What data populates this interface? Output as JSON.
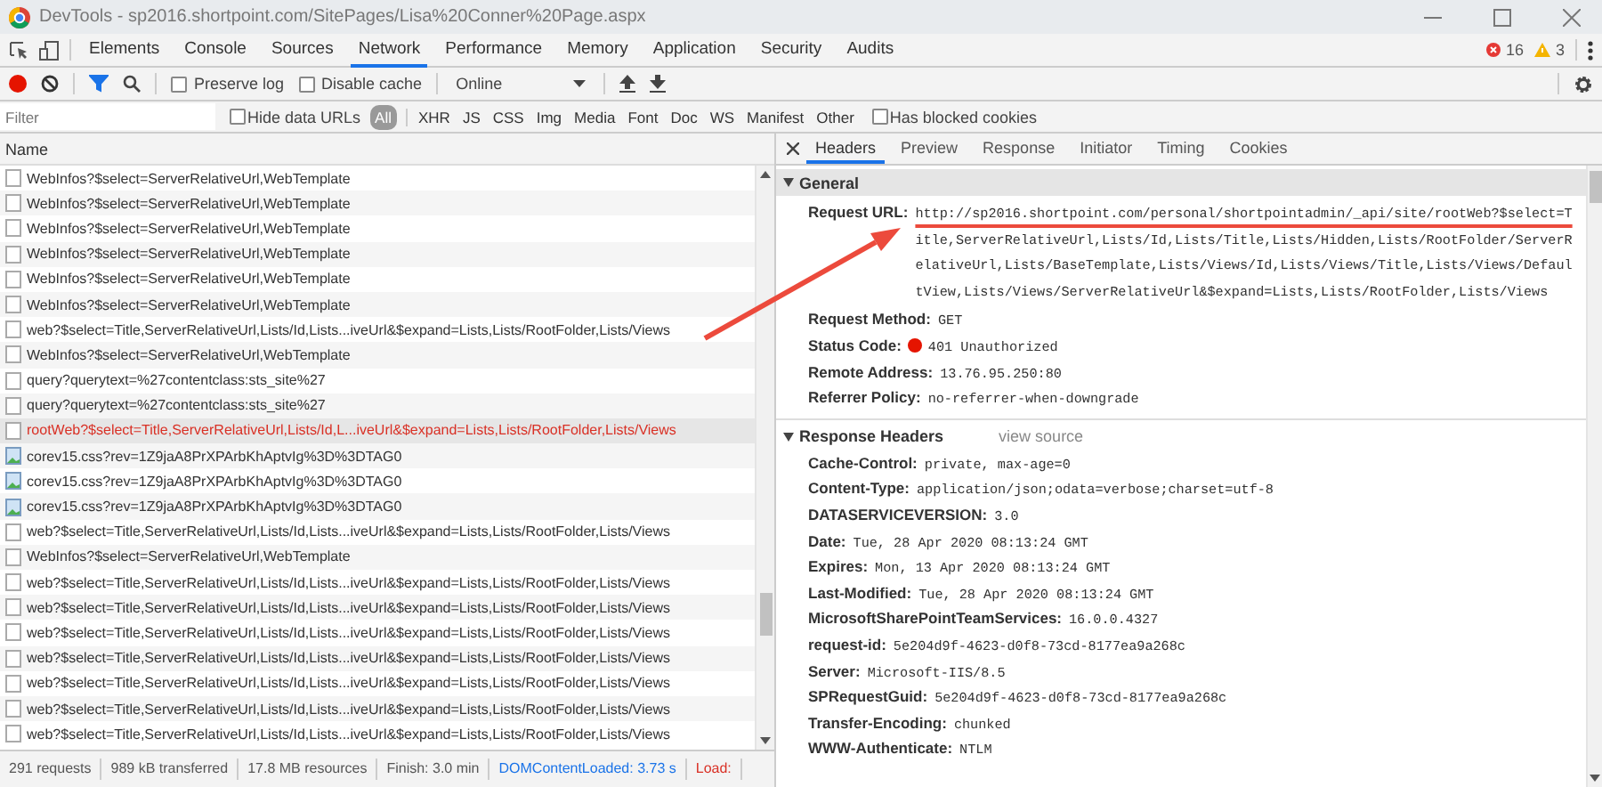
{
  "window": {
    "title": "DevTools - sp2016.shortpoint.com/SitePages/Lisa%20Conner%20Page.aspx"
  },
  "tabs": [
    {
      "label": "Elements",
      "selected": false
    },
    {
      "label": "Console",
      "selected": false
    },
    {
      "label": "Sources",
      "selected": false
    },
    {
      "label": "Network",
      "selected": true
    },
    {
      "label": "Performance",
      "selected": false
    },
    {
      "label": "Memory",
      "selected": false
    },
    {
      "label": "Application",
      "selected": false
    },
    {
      "label": "Security",
      "selected": false
    },
    {
      "label": "Audits",
      "selected": false
    }
  ],
  "counts": {
    "errors": "16",
    "warnings": "3"
  },
  "toolbar": {
    "recording": true,
    "filter_active": true,
    "preserve_log": {
      "label": "Preserve log",
      "checked": false
    },
    "disable_cache": {
      "label": "Disable cache",
      "checked": false
    },
    "throttling": "Online"
  },
  "filter": {
    "placeholder": "Filter",
    "hide_data_urls": {
      "label": "Hide data URLs",
      "checked": false
    },
    "types": [
      {
        "label": "All",
        "selected": true
      },
      {
        "label": "XHR",
        "selected": false
      },
      {
        "label": "JS",
        "selected": false
      },
      {
        "label": "CSS",
        "selected": false
      },
      {
        "label": "Img",
        "selected": false
      },
      {
        "label": "Media",
        "selected": false
      },
      {
        "label": "Font",
        "selected": false
      },
      {
        "label": "Doc",
        "selected": false
      },
      {
        "label": "WS",
        "selected": false
      },
      {
        "label": "Manifest",
        "selected": false
      },
      {
        "label": "Other",
        "selected": false
      }
    ],
    "has_blocked_cookies": {
      "label": "Has blocked cookies",
      "checked": false
    }
  },
  "requests": {
    "column": "Name",
    "rows": [
      {
        "name": "WebInfos?$select=ServerRelativeUrl,WebTemplate",
        "kind": "document",
        "selected": false,
        "error": false
      },
      {
        "name": "WebInfos?$select=ServerRelativeUrl,WebTemplate",
        "kind": "document",
        "selected": false,
        "error": false
      },
      {
        "name": "WebInfos?$select=ServerRelativeUrl,WebTemplate",
        "kind": "document",
        "selected": false,
        "error": false
      },
      {
        "name": "WebInfos?$select=ServerRelativeUrl,WebTemplate",
        "kind": "document",
        "selected": false,
        "error": false
      },
      {
        "name": "WebInfos?$select=ServerRelativeUrl,WebTemplate",
        "kind": "document",
        "selected": false,
        "error": false
      },
      {
        "name": "WebInfos?$select=ServerRelativeUrl,WebTemplate",
        "kind": "document",
        "selected": false,
        "error": false
      },
      {
        "name": "web?$select=Title,ServerRelativeUrl,Lists/Id,Lists...iveUrl&$expand=Lists,Lists/RootFolder,Lists/Views",
        "kind": "document",
        "selected": false,
        "error": false
      },
      {
        "name": "WebInfos?$select=ServerRelativeUrl,WebTemplate",
        "kind": "document",
        "selected": false,
        "error": false
      },
      {
        "name": "query?querytext=%27contentclass:sts_site%27",
        "kind": "document",
        "selected": false,
        "error": false
      },
      {
        "name": "query?querytext=%27contentclass:sts_site%27",
        "kind": "document",
        "selected": false,
        "error": false
      },
      {
        "name": "rootWeb?$select=Title,ServerRelativeUrl,Lists/Id,L...iveUrl&$expand=Lists,Lists/RootFolder,Lists/Views",
        "kind": "document",
        "selected": true,
        "error": true
      },
      {
        "name": "corev15.css?rev=1Z9jaA8PrXPArbKhAptvIg%3D%3DTAG0",
        "kind": "image",
        "selected": false,
        "error": false
      },
      {
        "name": "corev15.css?rev=1Z9jaA8PrXPArbKhAptvIg%3D%3DTAG0",
        "kind": "image",
        "selected": false,
        "error": false
      },
      {
        "name": "corev15.css?rev=1Z9jaA8PrXPArbKhAptvIg%3D%3DTAG0",
        "kind": "image",
        "selected": false,
        "error": false
      },
      {
        "name": "web?$select=Title,ServerRelativeUrl,Lists/Id,Lists...iveUrl&$expand=Lists,Lists/RootFolder,Lists/Views",
        "kind": "document",
        "selected": false,
        "error": false
      },
      {
        "name": "WebInfos?$select=ServerRelativeUrl,WebTemplate",
        "kind": "document",
        "selected": false,
        "error": false
      },
      {
        "name": "web?$select=Title,ServerRelativeUrl,Lists/Id,Lists...iveUrl&$expand=Lists,Lists/RootFolder,Lists/Views",
        "kind": "document",
        "selected": false,
        "error": false
      },
      {
        "name": "web?$select=Title,ServerRelativeUrl,Lists/Id,Lists...iveUrl&$expand=Lists,Lists/RootFolder,Lists/Views",
        "kind": "document",
        "selected": false,
        "error": false
      },
      {
        "name": "web?$select=Title,ServerRelativeUrl,Lists/Id,Lists...iveUrl&$expand=Lists,Lists/RootFolder,Lists/Views",
        "kind": "document",
        "selected": false,
        "error": false
      },
      {
        "name": "web?$select=Title,ServerRelativeUrl,Lists/Id,Lists...iveUrl&$expand=Lists,Lists/RootFolder,Lists/Views",
        "kind": "document",
        "selected": false,
        "error": false
      },
      {
        "name": "web?$select=Title,ServerRelativeUrl,Lists/Id,Lists...iveUrl&$expand=Lists,Lists/RootFolder,Lists/Views",
        "kind": "document",
        "selected": false,
        "error": false
      },
      {
        "name": "web?$select=Title,ServerRelativeUrl,Lists/Id,Lists...iveUrl&$expand=Lists,Lists/RootFolder,Lists/Views",
        "kind": "document",
        "selected": false,
        "error": false
      },
      {
        "name": "web?$select=Title,ServerRelativeUrl,Lists/Id,Lists...iveUrl&$expand=Lists,Lists/RootFolder,Lists/Views",
        "kind": "document",
        "selected": false,
        "error": false
      }
    ]
  },
  "status_bar": [
    {
      "text": "291 requests",
      "color": "#555555"
    },
    {
      "text": "989 kB transferred",
      "color": "#555555"
    },
    {
      "text": "17.8 MB resources",
      "color": "#555555"
    },
    {
      "text": "Finish: 3.0 min",
      "color": "#555555"
    },
    {
      "text": "DOMContentLoaded: 3.73 s",
      "color": "#1a73e8"
    },
    {
      "text": "Load:",
      "color": "#d93025"
    }
  ],
  "details": {
    "tabs": [
      {
        "label": "Headers",
        "selected": true
      },
      {
        "label": "Preview",
        "selected": false
      },
      {
        "label": "Response",
        "selected": false
      },
      {
        "label": "Initiator",
        "selected": false
      },
      {
        "label": "Timing",
        "selected": false
      },
      {
        "label": "Cookies",
        "selected": false
      }
    ],
    "general": {
      "title": "General",
      "expanded": true,
      "rows": [
        {
          "label": "Request URL:",
          "value": "http://sp2016.shortpoint.com/personal/shortpointadmin/_api/site/rootWeb?$select=Title,ServerRelativeUrl,Lists/Id,Lists/Title,Lists/Hidden,Lists/RootFolder/ServerRelativeUrl,Lists/BaseTemplate,Lists/Views/Id,Lists/Views/Title,Lists/Views/DefaultView,Lists/Views/ServerRelativeUrl&$expand=Lists,Lists/RootFolder,Lists/Views",
          "kind": "text"
        },
        {
          "label": "Request Method:",
          "value": "GET",
          "kind": "text"
        },
        {
          "label": "Status Code:",
          "value": "401 Unauthorized",
          "kind": "status"
        },
        {
          "label": "Remote Address:",
          "value": "13.76.95.250:80",
          "kind": "text"
        },
        {
          "label": "Referrer Policy:",
          "value": "no-referrer-when-downgrade",
          "kind": "text"
        }
      ]
    },
    "response": {
      "title": "Response Headers",
      "expanded": true,
      "link": "view source",
      "rows": [
        {
          "label": "Cache-Control:",
          "value": "private, max-age=0"
        },
        {
          "label": "Content-Type:",
          "value": "application/json;odata=verbose;charset=utf-8"
        },
        {
          "label": "DATASERVICEVERSION:",
          "value": "3.0"
        },
        {
          "label": "Date:",
          "value": "Tue, 28 Apr 2020 08:13:24 GMT"
        },
        {
          "label": "Expires:",
          "value": "Mon, 13 Apr 2020 08:13:24 GMT"
        },
        {
          "label": "Last-Modified:",
          "value": "Tue, 28 Apr 2020 08:13:24 GMT"
        },
        {
          "label": "MicrosoftSharePointTeamServices:",
          "value": "16.0.0.4327"
        },
        {
          "label": "request-id:",
          "value": "5e204d9f-4623-d0f8-73cd-8177ea9a268c"
        },
        {
          "label": "Server:",
          "value": "Microsoft-IIS/8.5"
        },
        {
          "label": "SPRequestGuid:",
          "value": "5e204d9f-4623-d0f8-73cd-8177ea9a268c"
        },
        {
          "label": "Transfer-Encoding:",
          "value": "chunked"
        },
        {
          "label": "WWW-Authenticate:",
          "value": "NTLM"
        }
      ]
    }
  }
}
